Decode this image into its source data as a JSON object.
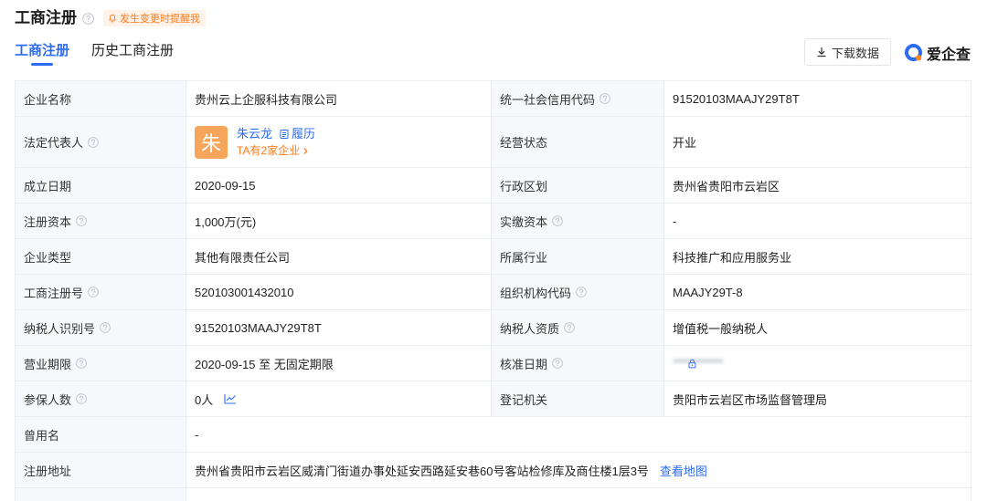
{
  "header": {
    "title": "工商注册",
    "alert_label": "发生变更时提醒我"
  },
  "tabs": [
    {
      "label": "工商注册"
    },
    {
      "label": "历史工商注册"
    }
  ],
  "toolbar": {
    "download_label": "下载数据"
  },
  "brand": {
    "name": "爱企查"
  },
  "colors": {
    "accent": "#2c6cf2",
    "warning": "#ff7a1a",
    "warning_bg": "#fff2e8",
    "label_bg": "#f6f8fb",
    "border": "#e9ecf1",
    "avatar_bg": "#f6a55a"
  },
  "icons": {
    "help": "help-icon",
    "alert": "bell-icon",
    "download": "download-icon",
    "resume": "document-icon",
    "more": "chevron-right-icon",
    "locked": "lock-icon",
    "trend": "line-chart-icon"
  },
  "fields": {
    "company_name": {
      "label": "企业名称",
      "value": "贵州云上企服科技有限公司"
    },
    "credit_code": {
      "label": "统一社会信用代码",
      "value": "91520103MAAJY29T8T"
    },
    "legal_rep": {
      "label": "法定代表人",
      "avatar_char": "朱",
      "name": "朱云龙",
      "resume_label": "履历",
      "companies_label": "TA有2家企业"
    },
    "business_status": {
      "label": "经营状态",
      "value": "开业"
    },
    "founded_date": {
      "label": "成立日期",
      "value": "2020-09-15"
    },
    "region": {
      "label": "行政区划",
      "value": "贵州省贵阳市云岩区"
    },
    "registered_capital": {
      "label": "注册资本",
      "value": "1,000万(元)"
    },
    "paid_in_capital": {
      "label": "实缴资本",
      "value": "-"
    },
    "company_type": {
      "label": "企业类型",
      "value": "其他有限责任公司"
    },
    "industry": {
      "label": "所属行业",
      "value": "科技推广和应用服务业"
    },
    "reg_number": {
      "label": "工商注册号",
      "value": "520103001432010"
    },
    "org_code": {
      "label": "组织机构代码",
      "value": "MAAJY29T-8"
    },
    "taxpayer_id": {
      "label": "纳税人识别号",
      "value": "91520103MAAJY29T8T"
    },
    "taxpayer_qualification": {
      "label": "纳税人资质",
      "value": "增值税一般纳税人"
    },
    "business_term": {
      "label": "营业期限",
      "value": "2020-09-15 至 无固定期限"
    },
    "approval_date": {
      "label": "核准日期"
    },
    "insured_count": {
      "label": "参保人数",
      "value": "0人"
    },
    "registration_authority": {
      "label": "登记机关",
      "value": "贵阳市云岩区市场监督管理局"
    },
    "former_name": {
      "label": "曾用名",
      "value": "-"
    },
    "registered_address": {
      "label": "注册地址",
      "value": "贵州省贵阳市云岩区威清门街道办事处延安西路延安巷60号客站检修库及商住楼1层3号",
      "map_link": "查看地图"
    }
  }
}
